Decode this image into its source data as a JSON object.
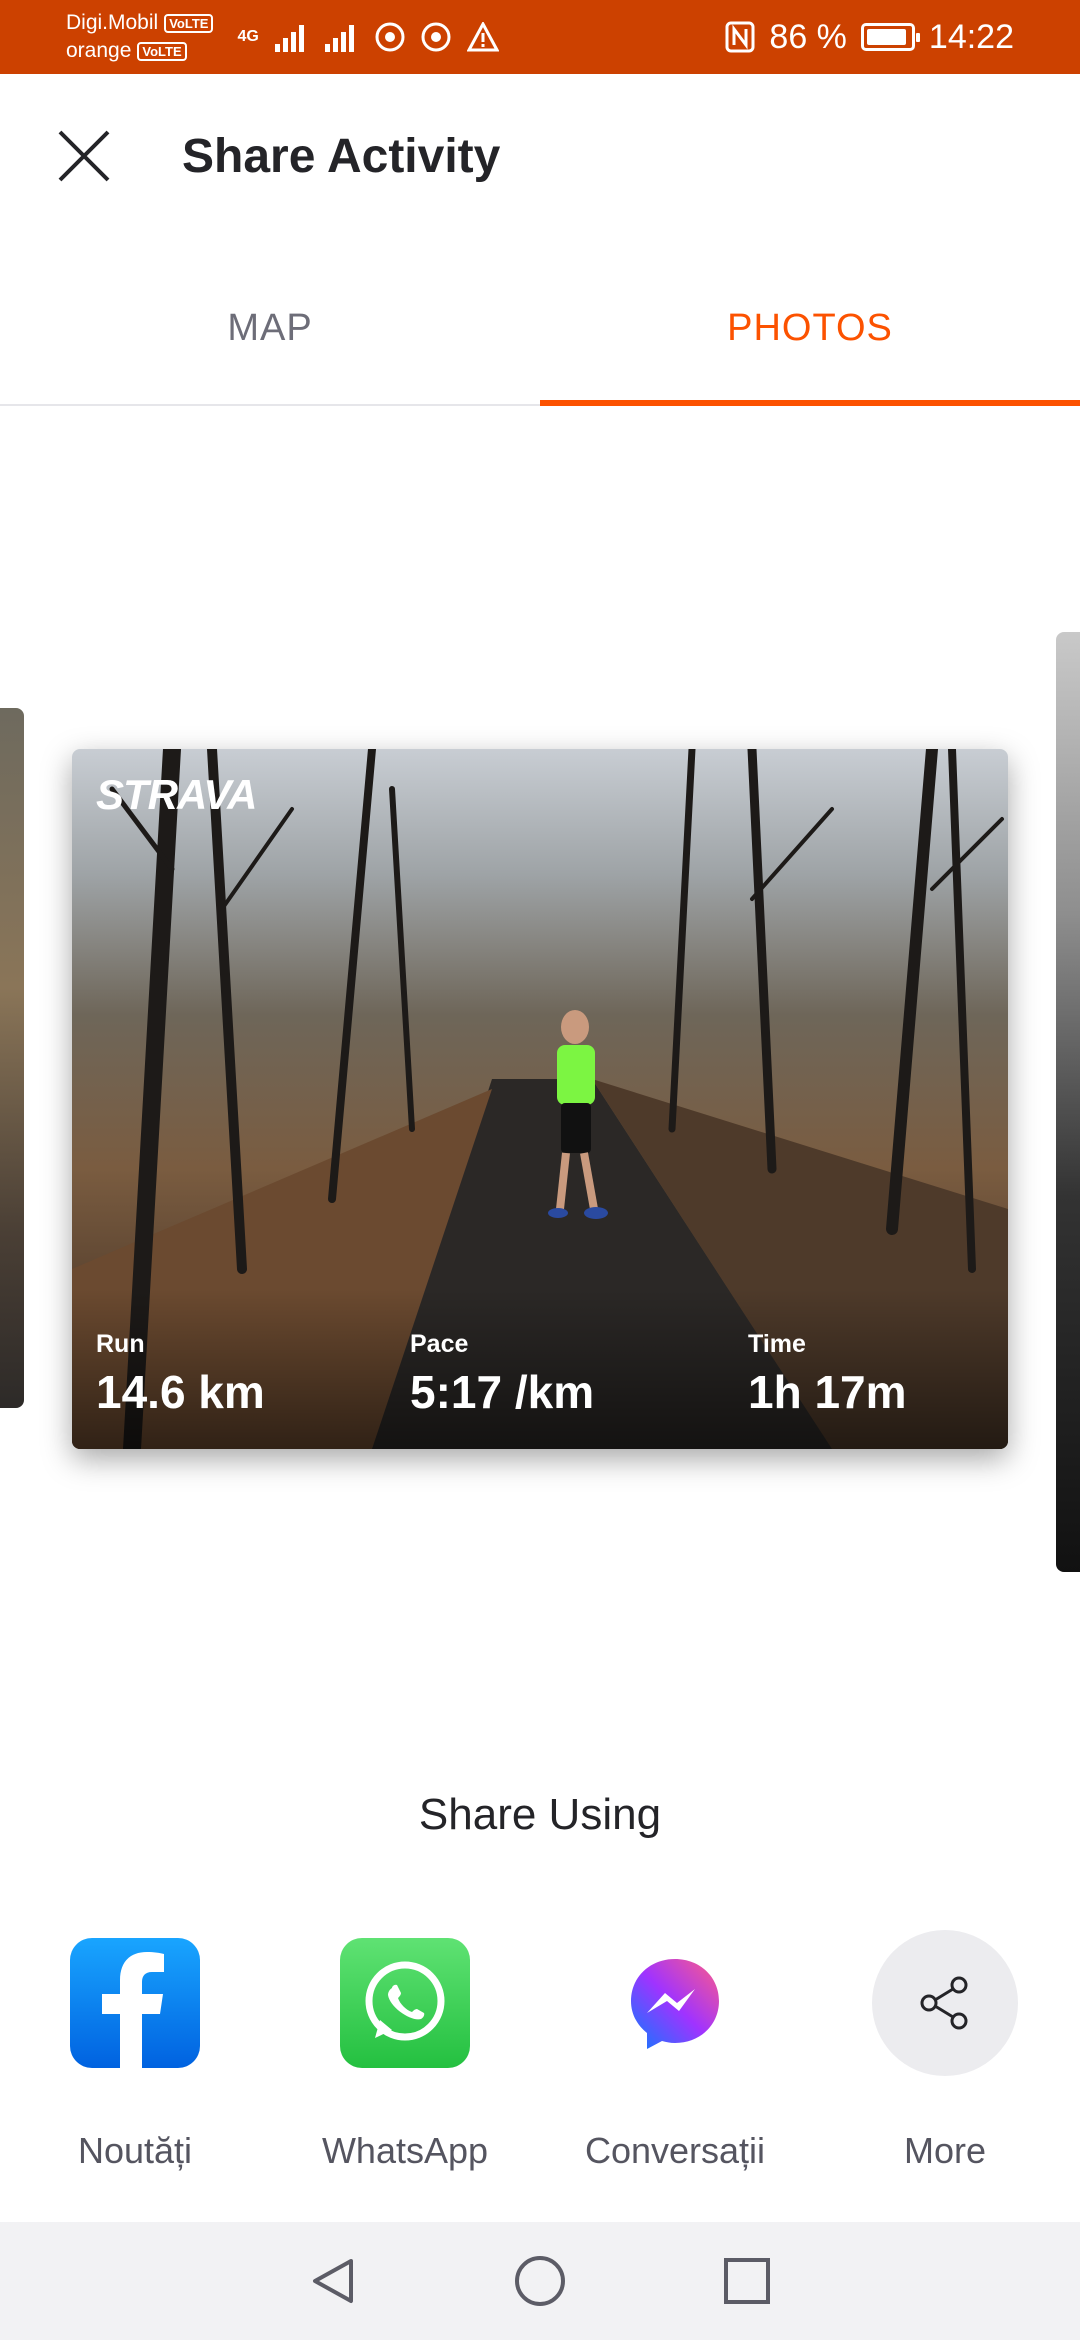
{
  "status_bar": {
    "carrier1": "Digi.Mobil",
    "carrier2": "orange",
    "volte": "VoLTE",
    "network": "4G",
    "battery_percent": "86 %",
    "battery_level": 0.86,
    "time": "14:22",
    "icons": [
      "signal-icon",
      "signal-icon",
      "chrome-icon",
      "chrome-icon",
      "warning-icon",
      "nfc-icon",
      "battery-icon"
    ]
  },
  "header": {
    "title": "Share Activity",
    "close_icon": "close-icon"
  },
  "tabs": [
    {
      "label": "MAP",
      "active": false
    },
    {
      "label": "PHOTOS",
      "active": true
    }
  ],
  "photo": {
    "logo": "STRAVA",
    "stats": [
      {
        "label": "Run",
        "value": "14.6 km"
      },
      {
        "label": "Pace",
        "value": "5:17 /km"
      },
      {
        "label": "Time",
        "value": "1h 17m"
      }
    ]
  },
  "share": {
    "title": "Share Using",
    "options": [
      {
        "label": "Noutăți",
        "icon": "facebook-icon"
      },
      {
        "label": "WhatsApp",
        "icon": "whatsapp-icon"
      },
      {
        "label": "Conversații",
        "icon": "messenger-icon"
      },
      {
        "label": "More",
        "icon": "share-icon"
      }
    ]
  },
  "nav": [
    "back-icon",
    "home-icon",
    "recents-icon"
  ],
  "colors": {
    "status_bar": "#cc4100",
    "accent": "#fc5200",
    "facebook": "#1877f2",
    "whatsapp": "#25d366"
  }
}
